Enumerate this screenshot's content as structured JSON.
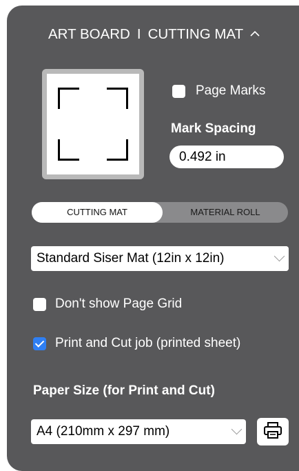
{
  "header": {
    "art_board": "ART BOARD",
    "separator": "I",
    "cutting_mat": "CUTTING MAT",
    "collapse_icon": "chevron-up-icon"
  },
  "marks": {
    "page_marks_label": "Page Marks",
    "page_marks_checked": false,
    "mark_spacing_label": "Mark Spacing",
    "mark_spacing_value": "0.492 in"
  },
  "mode_toggle": {
    "options": [
      "CUTTING MAT",
      "MATERIAL ROLL"
    ],
    "selected": "CUTTING MAT"
  },
  "mat_select": {
    "value": "Standard Siser Mat (12in x 12in)"
  },
  "options": {
    "dont_show_grid_label": "Don't show Page Grid",
    "dont_show_grid_checked": false,
    "print_cut_label": "Print and Cut job (printed sheet)",
    "print_cut_checked": true
  },
  "paper": {
    "label": "Paper Size (for Print and Cut)",
    "value": "A4 (210mm x 297 mm)",
    "print_icon": "printer-icon"
  },
  "colors": {
    "panel_bg": "#58585a",
    "checkbox_checked": "#2f7ff3",
    "preview_frame": "#b9b9b9"
  }
}
